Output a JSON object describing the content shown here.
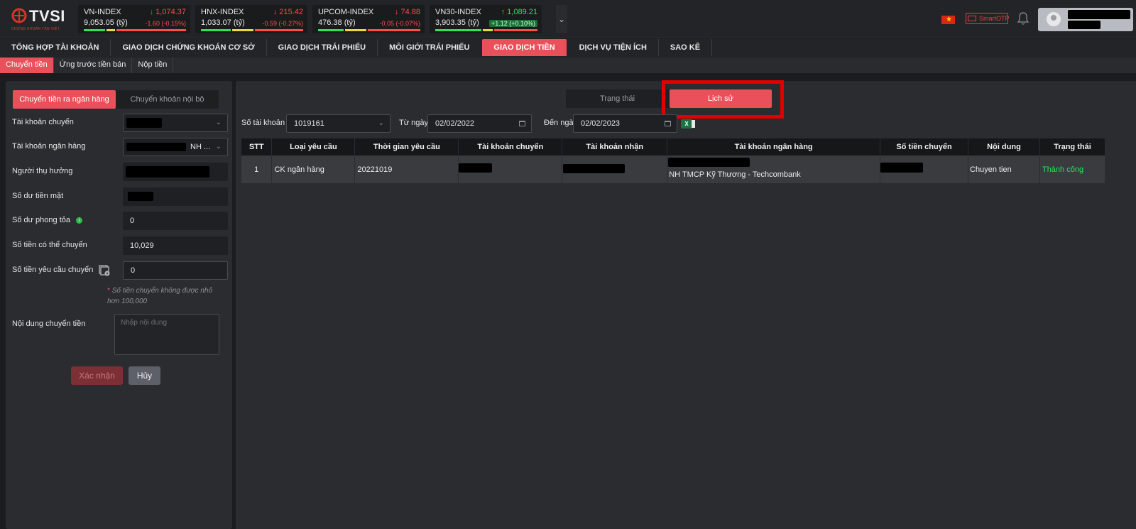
{
  "brand": {
    "name": "TVSI",
    "tagline": "CHỨNG KHOÁN TÂN VIỆT"
  },
  "indices": [
    {
      "name": "VN-INDEX",
      "value": "1,074.37",
      "sub": "9,053.05",
      "unit": "(tỷ)",
      "change": "-1.60  (-0.15%)",
      "direction": "down"
    },
    {
      "name": "HNX-INDEX",
      "value": "215.42",
      "sub": "1,033.07",
      "unit": "(tỷ)",
      "change": "-0.59  (-0.27%)",
      "direction": "down"
    },
    {
      "name": "UPCOM-INDEX",
      "value": "74.88",
      "sub": "476.38",
      "unit": "(tỷ)",
      "change": "-0.05  (-0.07%)",
      "direction": "down"
    },
    {
      "name": "VN30-INDEX",
      "value": "1,089.21",
      "sub": "3,903.35",
      "unit": "(tỷ)",
      "change": "+1.12  (+0.10%)",
      "direction": "up"
    }
  ],
  "header": {
    "otp_label": "SmartOTP"
  },
  "nav": {
    "items": [
      "TỔNG HỢP TÀI KHOẢN",
      "GIAO DỊCH CHỨNG KHOÁN CƠ SỞ",
      "GIAO DỊCH TRÁI PHIẾU",
      "MÔI GIỚI TRÁI PHIẾU",
      "GIAO DỊCH TIỀN",
      "DỊCH VỤ TIỆN ÍCH",
      "SAO KÊ"
    ],
    "active": "GIAO DỊCH TIỀN"
  },
  "subnav": {
    "items": [
      "Chuyển tiền",
      "Ứng trước tiền bán",
      "Nộp tiền"
    ],
    "active": "Chuyển tiền"
  },
  "form": {
    "seg_bank": "Chuyển tiền ra ngân hàng",
    "seg_internal": "Chuyển khoản nội bộ",
    "from_account_label": "Tài khoản chuyển",
    "bank_account_label": "Tài khoản ngân hàng",
    "bank_account_suffix": "NH ...",
    "beneficiary_label": "Người thụ hưởng",
    "cash_balance_label": "Số dư tiền mặt",
    "blocked_balance_label": "Số dư phong tỏa",
    "blocked_balance_value": "0",
    "transferable_label": "Số tiền có thể chuyển",
    "transferable_value": "10,029",
    "request_amount_label": "Số tiền yêu cầu chuyển",
    "request_amount_value": "0",
    "note_star": "*",
    "min_note": "Số tiền chuyển không được nhỏ hơn 100,000",
    "content_label": "Nội dung chuyển tiền",
    "content_placeholder": "Nhập nội dung",
    "confirm_label": "Xác nhận",
    "cancel_label": "Hủy"
  },
  "history": {
    "tab_status": "Trạng thái",
    "tab_history": "Lịch sử",
    "account_label": "Số tài khoản",
    "account_value": "1019161",
    "from_label": "Từ ngày",
    "from_value": "02/02/2022",
    "to_label": "Đến ngày",
    "to_value": "02/02/2023",
    "excel_label": "X",
    "columns": [
      "STT",
      "Loại yêu cầu",
      "Thời gian yêu cầu",
      "Tài khoản chuyển",
      "Tài khoản nhận",
      "Tài khoản ngân hàng",
      "Số tiền chuyển",
      "Nội dung",
      "Trạng thái"
    ],
    "rows": [
      {
        "stt": "1",
        "type": "CK ngân hàng",
        "time": "20221019",
        "bank": "NH TMCP Kỹ Thương - Techcombank",
        "content": "Chuyen tien",
        "status": "Thành công"
      }
    ]
  },
  "colors": {
    "accent": "#e9505a",
    "up": "#2ee05b",
    "down": "#ff4c4c",
    "highlight": "#e00000"
  }
}
